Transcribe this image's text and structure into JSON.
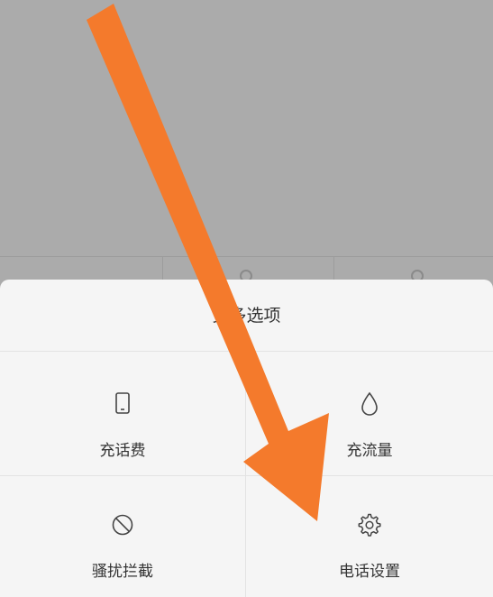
{
  "sheet": {
    "title": "更多选项",
    "items": [
      {
        "label": "充话费",
        "icon": "phone-icon"
      },
      {
        "label": "充流量",
        "icon": "water-drop-icon"
      },
      {
        "label": "骚扰拦截",
        "icon": "block-icon"
      },
      {
        "label": "电话设置",
        "icon": "gear-icon"
      }
    ]
  },
  "colors": {
    "overlay": "#ababab",
    "sheet_bg": "#f5f5f5",
    "text": "#333333",
    "arrow": "#f47a2c"
  },
  "annotation": {
    "icon": "arrow-pointer-icon"
  }
}
